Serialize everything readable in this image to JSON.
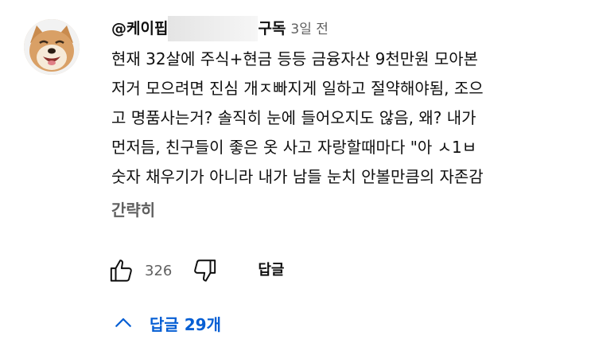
{
  "comment": {
    "author_prefix": "@케이핍",
    "author_suffix": "구독",
    "timestamp": "3일 전",
    "lines": [
      "현재 32살에 주식+현금 등등 금융자산 9천만원 모아본",
      "저거 모으려면 진심 개ㅈ빠지게 일하고 절약해야됨, 조으",
      "고 명품사는거? 솔직히 눈에 들어오지도 않음, 왜? 내가",
      "먼저듬, 친구들이 좋은 옷 사고 자랑할때마다 \"아 ㅅ1ㅂ",
      "숫자 채우기가 아니라 내가 남들 눈치 안볼만큼의 자존감"
    ],
    "show_less_label": "간략히",
    "like_count": "326",
    "reply_label": "답글",
    "replies_toggle_label": "답글 29개"
  },
  "icons": {
    "avatar": "shiba-inu-avatar",
    "like": "thumbs-up-icon",
    "dislike": "thumbs-down-icon",
    "chevron": "chevron-up-icon"
  },
  "colors": {
    "text": "#0f0f0f",
    "secondary": "#606060",
    "link_blue": "#065fd4"
  }
}
